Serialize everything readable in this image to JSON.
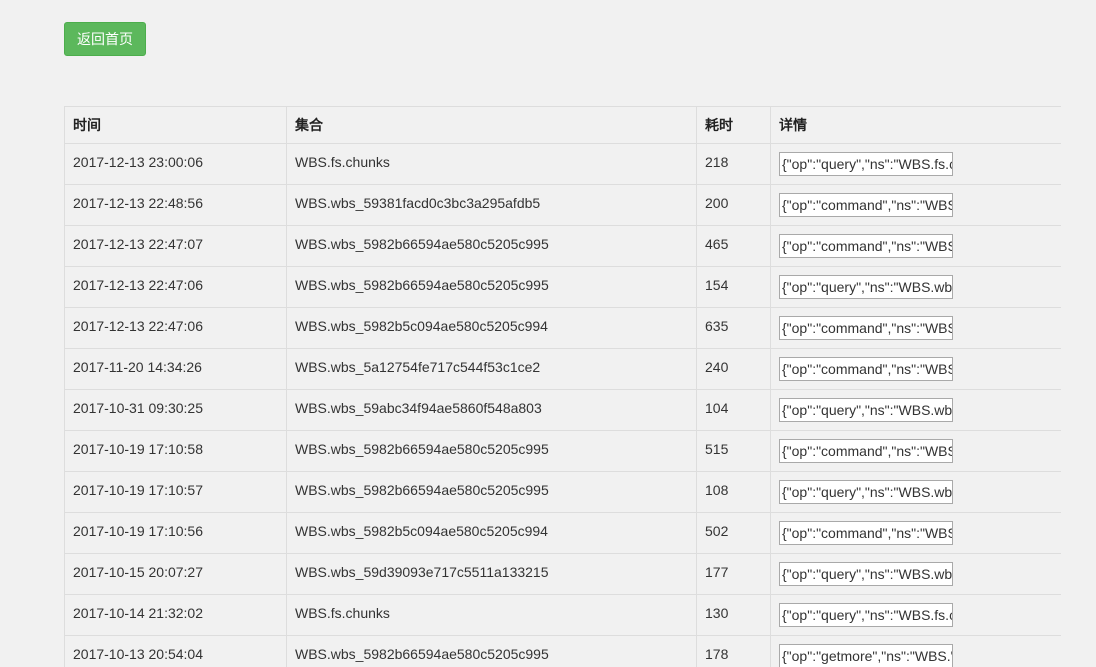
{
  "toolbar": {
    "home_label": "返回首页",
    "home_color": "#5cb85c"
  },
  "table": {
    "headers": {
      "time": "时间",
      "collection": "集合",
      "cost": "耗时",
      "detail": "详情"
    },
    "rows": [
      {
        "time": "2017-12-13 23:00:06",
        "collection": "WBS.fs.chunks",
        "cost": "218",
        "detail": "{\"op\":\"query\",\"ns\":\"WBS.fs.c"
      },
      {
        "time": "2017-12-13 22:48:56",
        "collection": "WBS.wbs_59381facd0c3bc3a295afdb5",
        "cost": "200",
        "detail": "{\"op\":\"command\",\"ns\":\"WBS"
      },
      {
        "time": "2017-12-13 22:47:07",
        "collection": "WBS.wbs_5982b66594ae580c5205c995",
        "cost": "465",
        "detail": "{\"op\":\"command\",\"ns\":\"WBS"
      },
      {
        "time": "2017-12-13 22:47:06",
        "collection": "WBS.wbs_5982b66594ae580c5205c995",
        "cost": "154",
        "detail": "{\"op\":\"query\",\"ns\":\"WBS.wb"
      },
      {
        "time": "2017-12-13 22:47:06",
        "collection": "WBS.wbs_5982b5c094ae580c5205c994",
        "cost": "635",
        "detail": "{\"op\":\"command\",\"ns\":\"WBS"
      },
      {
        "time": "2017-11-20 14:34:26",
        "collection": "WBS.wbs_5a12754fe717c544f53c1ce2",
        "cost": "240",
        "detail": "{\"op\":\"command\",\"ns\":\"WBS"
      },
      {
        "time": "2017-10-31 09:30:25",
        "collection": "WBS.wbs_59abc34f94ae5860f548a803",
        "cost": "104",
        "detail": "{\"op\":\"query\",\"ns\":\"WBS.wb"
      },
      {
        "time": "2017-10-19 17:10:58",
        "collection": "WBS.wbs_5982b66594ae580c5205c995",
        "cost": "515",
        "detail": "{\"op\":\"command\",\"ns\":\"WBS"
      },
      {
        "time": "2017-10-19 17:10:57",
        "collection": "WBS.wbs_5982b66594ae580c5205c995",
        "cost": "108",
        "detail": "{\"op\":\"query\",\"ns\":\"WBS.wb"
      },
      {
        "time": "2017-10-19 17:10:56",
        "collection": "WBS.wbs_5982b5c094ae580c5205c994",
        "cost": "502",
        "detail": "{\"op\":\"command\",\"ns\":\"WBS"
      },
      {
        "time": "2017-10-15 20:07:27",
        "collection": "WBS.wbs_59d39093e717c5511a133215",
        "cost": "177",
        "detail": "{\"op\":\"query\",\"ns\":\"WBS.wb"
      },
      {
        "time": "2017-10-14 21:32:02",
        "collection": "WBS.fs.chunks",
        "cost": "130",
        "detail": "{\"op\":\"query\",\"ns\":\"WBS.fs.c"
      },
      {
        "time": "2017-10-13 20:54:04",
        "collection": "WBS.wbs_5982b66594ae580c5205c995",
        "cost": "178",
        "detail": "{\"op\":\"getmore\",\"ns\":\"WBS.\""
      }
    ]
  }
}
